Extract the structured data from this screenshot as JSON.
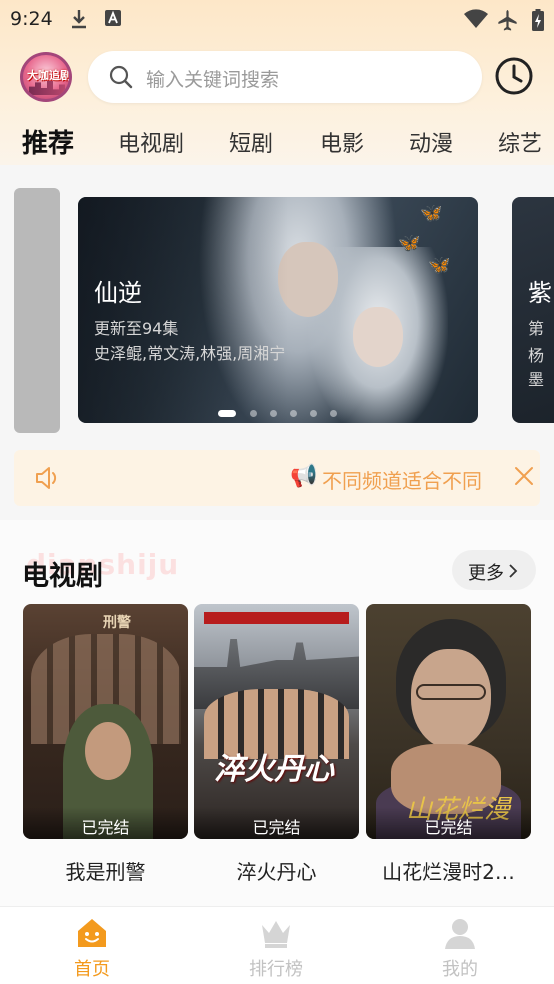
{
  "status_bar": {
    "time": "9:24"
  },
  "header": {
    "logo_text": "大咖追剧",
    "search_placeholder": "输入关键词搜索"
  },
  "tabs": [
    {
      "label": "推荐",
      "active": true
    },
    {
      "label": "电视剧"
    },
    {
      "label": "短剧"
    },
    {
      "label": "电影"
    },
    {
      "label": "动漫"
    },
    {
      "label": "综艺"
    }
  ],
  "banner": {
    "title": "仙逆",
    "update": "更新至94集",
    "cast": "史泽鲲,常文涛,林强,周湘宁",
    "page_count": 6,
    "active_index": 0,
    "next_peek": {
      "title": "紫",
      "lines": [
        "第",
        "杨",
        "墨"
      ]
    }
  },
  "notice": {
    "text": "不同频道适合不同"
  },
  "section": {
    "title": "电视剧",
    "ghost_text": "dianshiju",
    "more_label": "更多",
    "cards": [
      {
        "title": "我是刑警",
        "badge": "已完结",
        "poster_text": "刑警"
      },
      {
        "title": "淬火丹心",
        "badge": "已完结",
        "poster_text": "淬火丹心"
      },
      {
        "title": "山花烂漫时2…",
        "badge": "已完结",
        "poster_text": "山花烂漫"
      }
    ]
  },
  "bottom_nav": [
    {
      "label": "首页",
      "active": true
    },
    {
      "label": "排行榜"
    },
    {
      "label": "我的"
    }
  ],
  "colors": {
    "accent": "#f39a1e",
    "tab_underline": "#f9c74f",
    "notice_text": "#f0a050"
  }
}
